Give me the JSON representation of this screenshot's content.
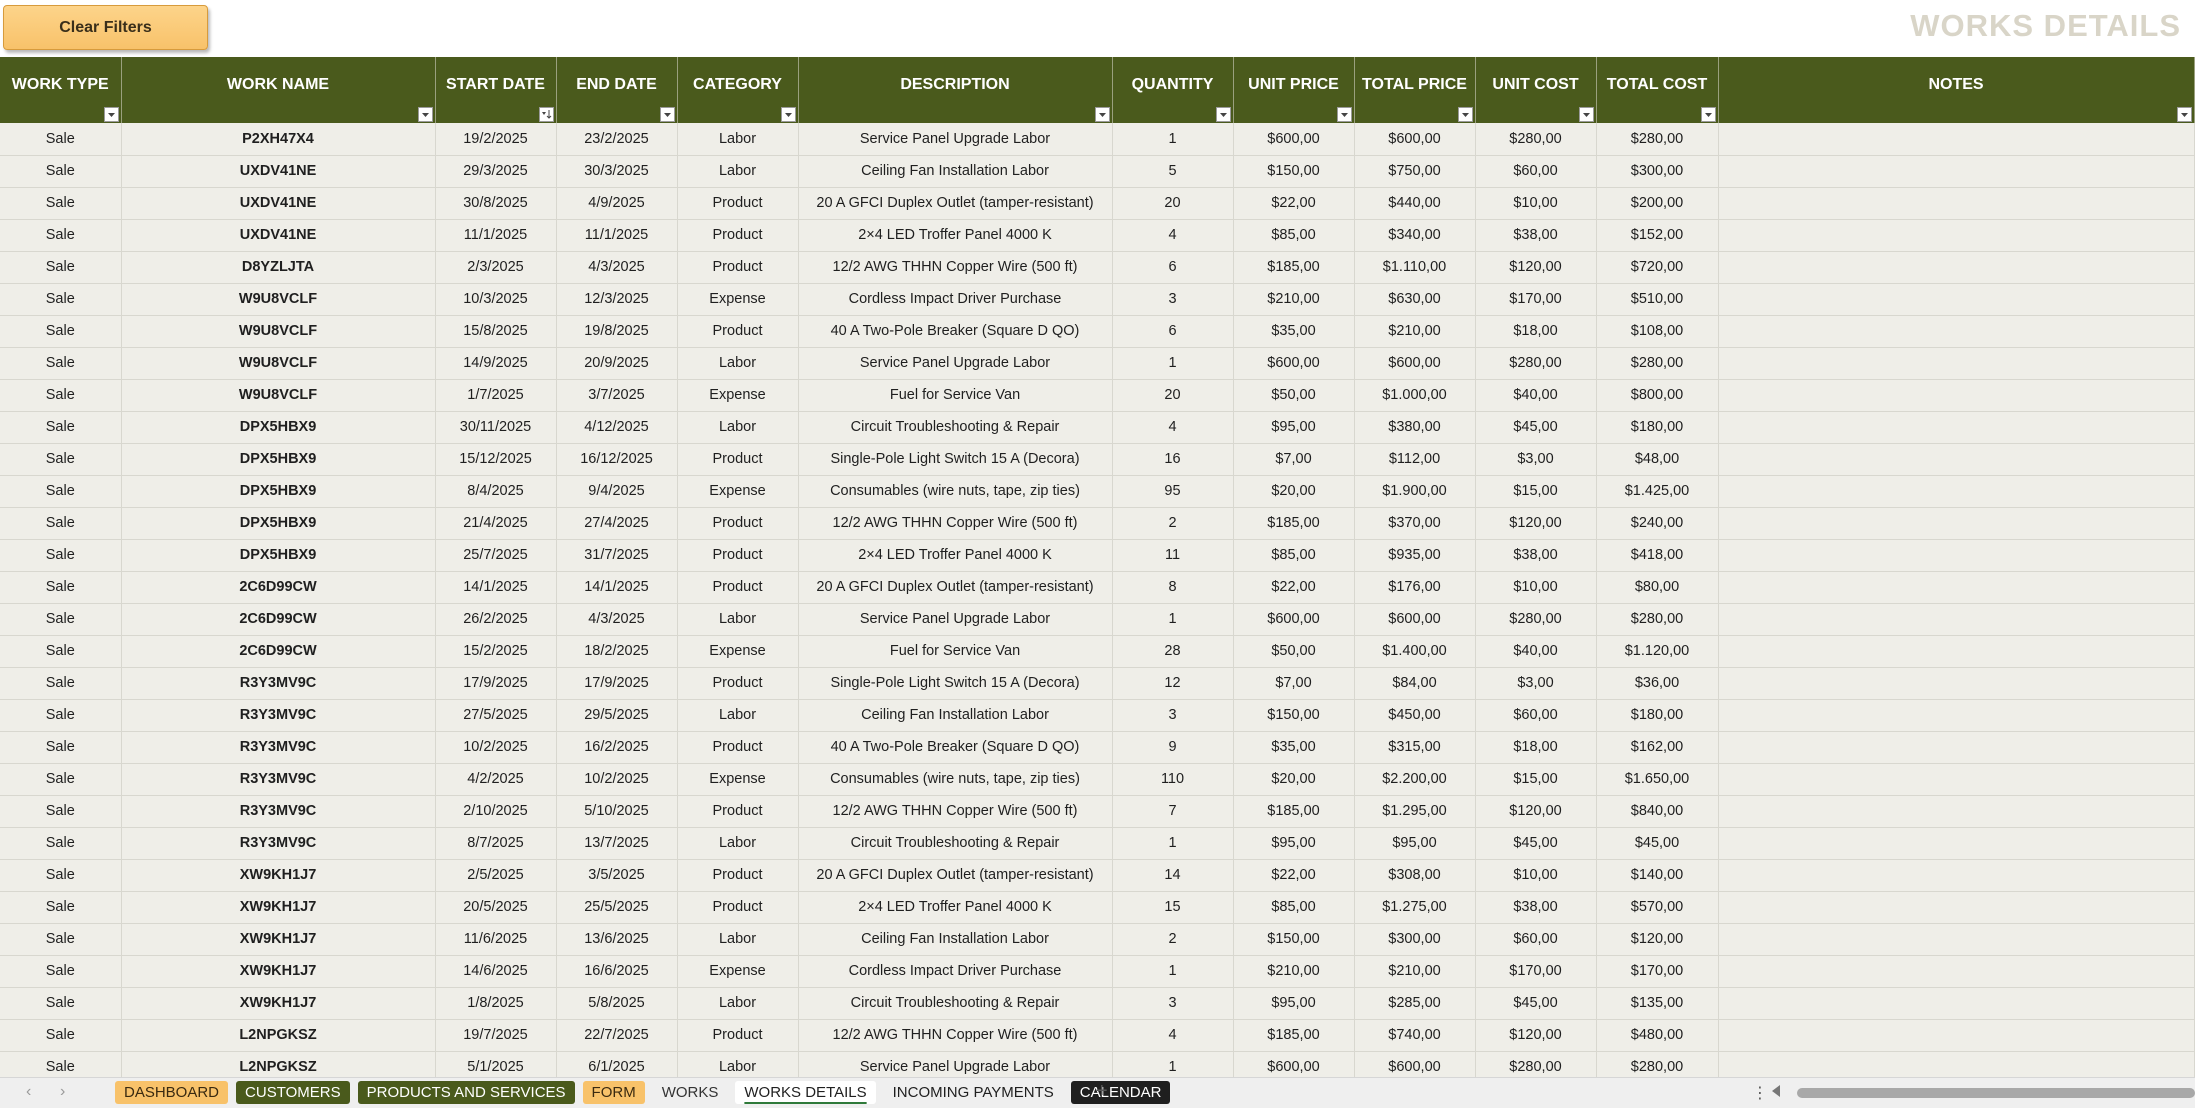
{
  "toolbar": {
    "clear_filters_label": "Clear Filters"
  },
  "page_title": "WORKS DETAILS",
  "table": {
    "columns": [
      "WORK TYPE",
      "WORK NAME",
      "START DATE",
      "END DATE",
      "CATEGORY",
      "DESCRIPTION",
      "QUANTITY",
      "UNIT PRICE",
      "TOTAL PRICE",
      "UNIT COST",
      "TOTAL COST",
      "NOTES"
    ],
    "rows": [
      [
        "Sale",
        "P2XH47X4",
        "19/2/2025",
        "23/2/2025",
        "Labor",
        "Service Panel Upgrade Labor",
        "1",
        "$600,00",
        "$600,00",
        "$280,00",
        "$280,00",
        ""
      ],
      [
        "Sale",
        "UXDV41NE",
        "29/3/2025",
        "30/3/2025",
        "Labor",
        "Ceiling Fan Installation Labor",
        "5",
        "$150,00",
        "$750,00",
        "$60,00",
        "$300,00",
        ""
      ],
      [
        "Sale",
        "UXDV41NE",
        "30/8/2025",
        "4/9/2025",
        "Product",
        "20 A GFCI Duplex Outlet (tamper-resistant)",
        "20",
        "$22,00",
        "$440,00",
        "$10,00",
        "$200,00",
        ""
      ],
      [
        "Sale",
        "UXDV41NE",
        "11/1/2025",
        "11/1/2025",
        "Product",
        "2×4 LED Troffer Panel 4000 K",
        "4",
        "$85,00",
        "$340,00",
        "$38,00",
        "$152,00",
        ""
      ],
      [
        "Sale",
        "D8YZLJTA",
        "2/3/2025",
        "4/3/2025",
        "Product",
        "12/2 AWG THHN Copper Wire (500 ft)",
        "6",
        "$185,00",
        "$1.110,00",
        "$120,00",
        "$720,00",
        ""
      ],
      [
        "Sale",
        "W9U8VCLF",
        "10/3/2025",
        "12/3/2025",
        "Expense",
        "Cordless Impact Driver Purchase",
        "3",
        "$210,00",
        "$630,00",
        "$170,00",
        "$510,00",
        ""
      ],
      [
        "Sale",
        "W9U8VCLF",
        "15/8/2025",
        "19/8/2025",
        "Product",
        "40 A Two-Pole Breaker (Square D QO)",
        "6",
        "$35,00",
        "$210,00",
        "$18,00",
        "$108,00",
        ""
      ],
      [
        "Sale",
        "W9U8VCLF",
        "14/9/2025",
        "20/9/2025",
        "Labor",
        "Service Panel Upgrade Labor",
        "1",
        "$600,00",
        "$600,00",
        "$280,00",
        "$280,00",
        ""
      ],
      [
        "Sale",
        "W9U8VCLF",
        "1/7/2025",
        "3/7/2025",
        "Expense",
        "Fuel for Service Van",
        "20",
        "$50,00",
        "$1.000,00",
        "$40,00",
        "$800,00",
        ""
      ],
      [
        "Sale",
        "DPX5HBX9",
        "30/11/2025",
        "4/12/2025",
        "Labor",
        "Circuit Troubleshooting & Repair",
        "4",
        "$95,00",
        "$380,00",
        "$45,00",
        "$180,00",
        ""
      ],
      [
        "Sale",
        "DPX5HBX9",
        "15/12/2025",
        "16/12/2025",
        "Product",
        "Single-Pole Light Switch 15 A (Decora)",
        "16",
        "$7,00",
        "$112,00",
        "$3,00",
        "$48,00",
        ""
      ],
      [
        "Sale",
        "DPX5HBX9",
        "8/4/2025",
        "9/4/2025",
        "Expense",
        "Consumables (wire nuts, tape, zip ties)",
        "95",
        "$20,00",
        "$1.900,00",
        "$15,00",
        "$1.425,00",
        ""
      ],
      [
        "Sale",
        "DPX5HBX9",
        "21/4/2025",
        "27/4/2025",
        "Product",
        "12/2 AWG THHN Copper Wire (500 ft)",
        "2",
        "$185,00",
        "$370,00",
        "$120,00",
        "$240,00",
        ""
      ],
      [
        "Sale",
        "DPX5HBX9",
        "25/7/2025",
        "31/7/2025",
        "Product",
        "2×4 LED Troffer Panel 4000 K",
        "11",
        "$85,00",
        "$935,00",
        "$38,00",
        "$418,00",
        ""
      ],
      [
        "Sale",
        "2C6D99CW",
        "14/1/2025",
        "14/1/2025",
        "Product",
        "20 A GFCI Duplex Outlet (tamper-resistant)",
        "8",
        "$22,00",
        "$176,00",
        "$10,00",
        "$80,00",
        ""
      ],
      [
        "Sale",
        "2C6D99CW",
        "26/2/2025",
        "4/3/2025",
        "Labor",
        "Service Panel Upgrade Labor",
        "1",
        "$600,00",
        "$600,00",
        "$280,00",
        "$280,00",
        ""
      ],
      [
        "Sale",
        "2C6D99CW",
        "15/2/2025",
        "18/2/2025",
        "Expense",
        "Fuel for Service Van",
        "28",
        "$50,00",
        "$1.400,00",
        "$40,00",
        "$1.120,00",
        ""
      ],
      [
        "Sale",
        "R3Y3MV9C",
        "17/9/2025",
        "17/9/2025",
        "Product",
        "Single-Pole Light Switch 15 A (Decora)",
        "12",
        "$7,00",
        "$84,00",
        "$3,00",
        "$36,00",
        ""
      ],
      [
        "Sale",
        "R3Y3MV9C",
        "27/5/2025",
        "29/5/2025",
        "Labor",
        "Ceiling Fan Installation Labor",
        "3",
        "$150,00",
        "$450,00",
        "$60,00",
        "$180,00",
        ""
      ],
      [
        "Sale",
        "R3Y3MV9C",
        "10/2/2025",
        "16/2/2025",
        "Product",
        "40 A Two-Pole Breaker (Square D QO)",
        "9",
        "$35,00",
        "$315,00",
        "$18,00",
        "$162,00",
        ""
      ],
      [
        "Sale",
        "R3Y3MV9C",
        "4/2/2025",
        "10/2/2025",
        "Expense",
        "Consumables (wire nuts, tape, zip ties)",
        "110",
        "$20,00",
        "$2.200,00",
        "$15,00",
        "$1.650,00",
        ""
      ],
      [
        "Sale",
        "R3Y3MV9C",
        "2/10/2025",
        "5/10/2025",
        "Product",
        "12/2 AWG THHN Copper Wire (500 ft)",
        "7",
        "$185,00",
        "$1.295,00",
        "$120,00",
        "$840,00",
        ""
      ],
      [
        "Sale",
        "R3Y3MV9C",
        "8/7/2025",
        "13/7/2025",
        "Labor",
        "Circuit Troubleshooting & Repair",
        "1",
        "$95,00",
        "$95,00",
        "$45,00",
        "$45,00",
        ""
      ],
      [
        "Sale",
        "XW9KH1J7",
        "2/5/2025",
        "3/5/2025",
        "Product",
        "20 A GFCI Duplex Outlet (tamper-resistant)",
        "14",
        "$22,00",
        "$308,00",
        "$10,00",
        "$140,00",
        ""
      ],
      [
        "Sale",
        "XW9KH1J7",
        "20/5/2025",
        "25/5/2025",
        "Product",
        "2×4 LED Troffer Panel 4000 K",
        "15",
        "$85,00",
        "$1.275,00",
        "$38,00",
        "$570,00",
        ""
      ],
      [
        "Sale",
        "XW9KH1J7",
        "11/6/2025",
        "13/6/2025",
        "Labor",
        "Ceiling Fan Installation Labor",
        "2",
        "$150,00",
        "$300,00",
        "$60,00",
        "$120,00",
        ""
      ],
      [
        "Sale",
        "XW9KH1J7",
        "14/6/2025",
        "16/6/2025",
        "Expense",
        "Cordless Impact Driver Purchase",
        "1",
        "$210,00",
        "$210,00",
        "$170,00",
        "$170,00",
        ""
      ],
      [
        "Sale",
        "XW9KH1J7",
        "1/8/2025",
        "5/8/2025",
        "Labor",
        "Circuit Troubleshooting & Repair",
        "3",
        "$95,00",
        "$285,00",
        "$45,00",
        "$135,00",
        ""
      ],
      [
        "Sale",
        "L2NPGKSZ",
        "19/7/2025",
        "22/7/2025",
        "Product",
        "12/2 AWG THHN Copper Wire (500 ft)",
        "4",
        "$185,00",
        "$740,00",
        "$120,00",
        "$480,00",
        ""
      ],
      [
        "Sale",
        "L2NPGKSZ",
        "5/1/2025",
        "6/1/2025",
        "Labor",
        "Service Panel Upgrade Labor",
        "1",
        "$600,00",
        "$600,00",
        "$280,00",
        "$280,00",
        ""
      ]
    ]
  },
  "sheet_tabs": [
    {
      "label": "DASHBOARD",
      "bg": "#f8c26a",
      "color": "#3a2a10",
      "active": false
    },
    {
      "label": "CUSTOMERS",
      "bg": "#4a5a1c",
      "color": "#ffffff",
      "active": false
    },
    {
      "label": "PRODUCTS AND SERVICES",
      "bg": "#4a5a1c",
      "color": "#ffffff",
      "active": false
    },
    {
      "label": "FORM",
      "bg": "#f8c26a",
      "color": "#3a2a10",
      "active": false
    },
    {
      "label": "WORKS",
      "bg": "transparent",
      "color": "#333333",
      "active": false
    },
    {
      "label": "WORKS DETAILS",
      "bg": "#ffffff",
      "color": "#1f1f1f",
      "active": true
    },
    {
      "label": "INCOMING PAYMENTS",
      "bg": "transparent",
      "color": "#1f1f1f",
      "active": false
    },
    {
      "label": "CALENDAR",
      "bg": "#1f1f1f",
      "color": "#ffffff",
      "active": false
    }
  ],
  "icons": {
    "filter": "filter-dropdown-icon",
    "sorted_filter": "sort-filter-icon",
    "prev_sheet": "chevron-left-icon",
    "next_sheet": "chevron-right-icon",
    "add_sheet": "plus-icon",
    "more": "more-vertical-icon"
  },
  "colors": {
    "header_bg": "#4a5a1c",
    "row_bg": "#efeee8",
    "button_bg": "#f8c26a",
    "title": "#d9d5c8"
  }
}
